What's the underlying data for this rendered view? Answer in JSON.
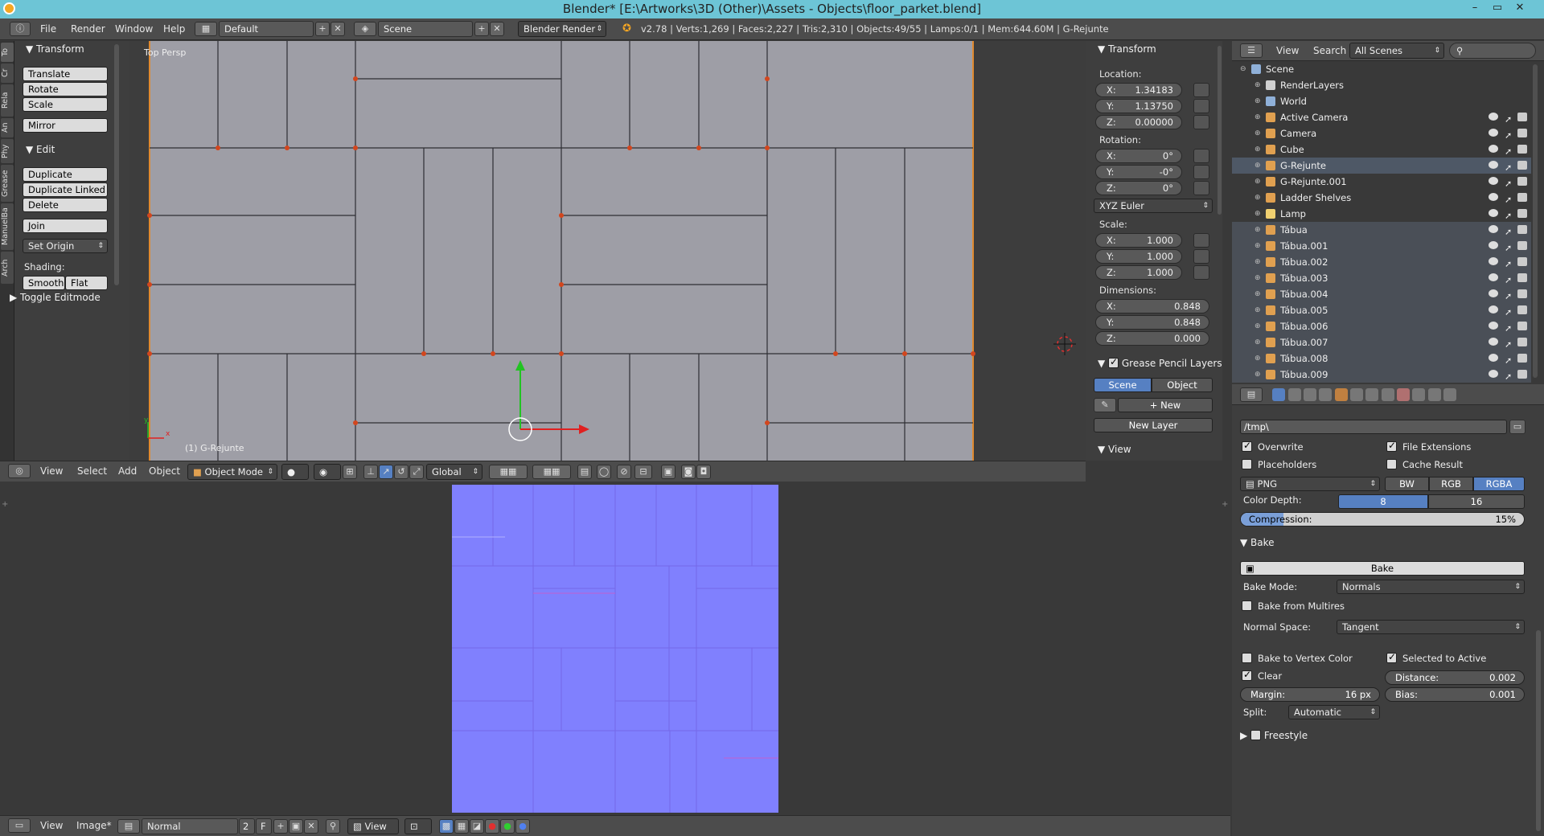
{
  "window": {
    "title": "Blender* [E:\\Artworks\\3D (Other)\\Assets - Objects\\floor_parket.blend]",
    "minimize": "–",
    "maximize": "▭",
    "close": "✕"
  },
  "infobar": {
    "menus": [
      "File",
      "Render",
      "Window",
      "Help"
    ],
    "layout": "Default",
    "scene": "Scene",
    "engine": "Blender Render",
    "stats": "v2.78 | Verts:1,269 | Faces:2,227 | Tris:2,310 | Objects:49/55 | Lamps:0/1 | Mem:644.60M | G-Rejunte"
  },
  "toolshelf": {
    "tabs": [
      "To",
      "Cr",
      "Rela",
      "An",
      "Phy",
      "Grease",
      "ManuelBa",
      "Arch"
    ],
    "transform_header": "Transform",
    "transform_buttons": [
      "Translate",
      "Rotate",
      "Scale"
    ],
    "mirror": "Mirror",
    "edit_header": "Edit",
    "edit_buttons": [
      "Duplicate",
      "Duplicate Linked",
      "Delete"
    ],
    "join": "Join",
    "set_origin": "Set Origin",
    "shading_label": "Shading:",
    "smooth": "Smooth",
    "flat": "Flat",
    "toggle_editmode": "Toggle Editmode"
  },
  "viewport": {
    "view_label": "Top Persp",
    "object_label": "(1) G-Rejunte",
    "axis_x": "x",
    "axis_y": "y"
  },
  "viewport_header": {
    "menus": [
      "View",
      "Select",
      "Add",
      "Object"
    ],
    "mode": "Object Mode",
    "orientation": "Global"
  },
  "npanel": {
    "transform_header": "Transform",
    "location_label": "Location:",
    "location": [
      {
        "k": "X:",
        "v": "1.34183"
      },
      {
        "k": "Y:",
        "v": "1.13750"
      },
      {
        "k": "Z:",
        "v": "0.00000"
      }
    ],
    "rotation_label": "Rotation:",
    "rotation": [
      {
        "k": "X:",
        "v": "0°"
      },
      {
        "k": "Y:",
        "v": "-0°"
      },
      {
        "k": "Z:",
        "v": "0°"
      }
    ],
    "rotation_mode": "XYZ Euler",
    "scale_label": "Scale:",
    "scale": [
      {
        "k": "X:",
        "v": "1.000"
      },
      {
        "k": "Y:",
        "v": "1.000"
      },
      {
        "k": "Z:",
        "v": "1.000"
      }
    ],
    "dimensions_label": "Dimensions:",
    "dimensions": [
      {
        "k": "X:",
        "v": "0.848"
      },
      {
        "k": "Y:",
        "v": "0.848"
      },
      {
        "k": "Z:",
        "v": "0.000"
      }
    ],
    "grease_header": "Grease Pencil Layers",
    "scene_btn": "Scene",
    "object_btn": "Object",
    "new_btn": "New",
    "new_layer_btn": "New Layer",
    "view_header": "View"
  },
  "image_editor_header": {
    "menus": [
      "View",
      "Image*"
    ],
    "image_name": "Normal",
    "users": "2",
    "fake": "F",
    "view": "View"
  },
  "outliner": {
    "menus": [
      "View",
      "Search"
    ],
    "display": "All Scenes",
    "rows": [
      {
        "name": "Scene",
        "indent": 0,
        "color": "#8fb0d8"
      },
      {
        "name": "RenderLayers",
        "indent": 1,
        "color": "#cfcfcf"
      },
      {
        "name": "World",
        "indent": 1,
        "color": "#8fb0d8"
      },
      {
        "name": "Active Camera",
        "indent": 1,
        "color": "#e0a050"
      },
      {
        "name": "Camera",
        "indent": 1,
        "color": "#e0a050"
      },
      {
        "name": "Cube",
        "indent": 1,
        "color": "#e0a050"
      },
      {
        "name": "G-Rejunte",
        "indent": 1,
        "color": "#e0a050",
        "selected": true
      },
      {
        "name": "G-Rejunte.001",
        "indent": 1,
        "color": "#e0a050"
      },
      {
        "name": "Ladder Shelves",
        "indent": 1,
        "color": "#e0a050"
      },
      {
        "name": "Lamp",
        "indent": 1,
        "color": "#f0d070"
      },
      {
        "name": "Tábua",
        "indent": 1,
        "color": "#e0a050",
        "highlight": true
      },
      {
        "name": "Tábua.001",
        "indent": 1,
        "color": "#e0a050",
        "highlight": true
      },
      {
        "name": "Tábua.002",
        "indent": 1,
        "color": "#e0a050",
        "highlight": true
      },
      {
        "name": "Tábua.003",
        "indent": 1,
        "color": "#e0a050",
        "highlight": true
      },
      {
        "name": "Tábua.004",
        "indent": 1,
        "color": "#e0a050",
        "highlight": true
      },
      {
        "name": "Tábua.005",
        "indent": 1,
        "color": "#e0a050",
        "highlight": true
      },
      {
        "name": "Tábua.006",
        "indent": 1,
        "color": "#e0a050",
        "highlight": true
      },
      {
        "name": "Tábua.007",
        "indent": 1,
        "color": "#e0a050",
        "highlight": true
      },
      {
        "name": "Tábua.008",
        "indent": 1,
        "color": "#e0a050",
        "highlight": true
      },
      {
        "name": "Tábua.009",
        "indent": 1,
        "color": "#e0a050",
        "highlight": true
      }
    ]
  },
  "properties": {
    "output_path": "/tmp\\",
    "overwrite": "Overwrite",
    "file_extensions": "File Extensions",
    "placeholders": "Placeholders",
    "cache_result": "Cache Result",
    "format": "PNG",
    "bw": "BW",
    "rgb": "RGB",
    "rgba": "RGBA",
    "color_depth_label": "Color Depth:",
    "depth_8": "8",
    "depth_16": "16",
    "compression_label": "Compression:",
    "compression_value": "15%",
    "compression_fraction": 0.15,
    "bake_header": "Bake",
    "bake_btn": "Bake",
    "bake_mode_label": "Bake Mode:",
    "bake_mode": "Normals",
    "bake_from_multires": "Bake from Multires",
    "normal_space_label": "Normal Space:",
    "normal_space": "Tangent",
    "bake_to_vertex": "Bake to Vertex Color",
    "selected_to_active": "Selected to Active",
    "clear": "Clear",
    "distance_label": "Distance:",
    "distance_value": "0.002",
    "margin_label": "Margin:",
    "margin_value": "16 px",
    "bias_label": "Bias:",
    "bias_value": "0.001",
    "split_label": "Split:",
    "split_value": "Automatic",
    "freestyle_header": "Freestyle"
  }
}
